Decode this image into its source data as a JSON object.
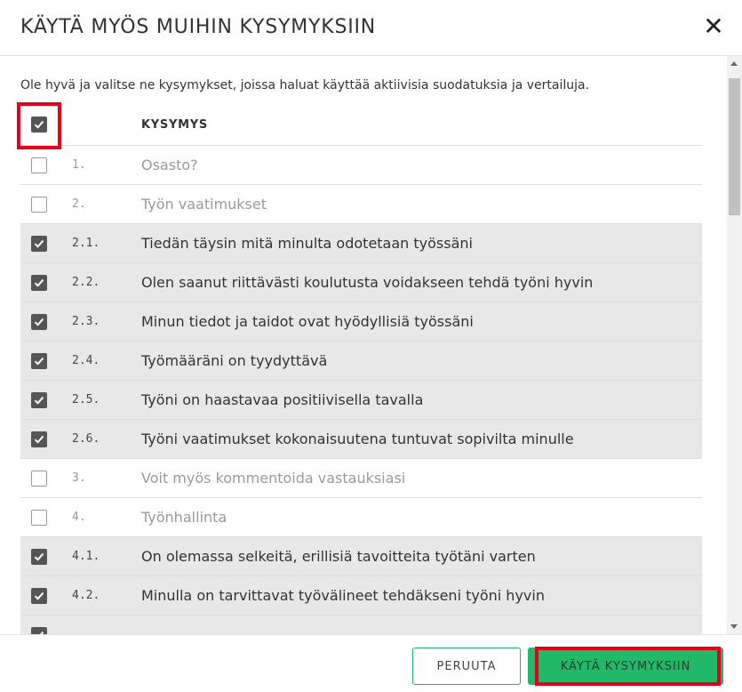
{
  "dialog": {
    "title": "KÄYTÄ MYÖS MUIHIN KYSYMYKSIIN",
    "close_icon": "close-icon",
    "intro": "Ole hyvä ja valitse ne kysymykset, joissa haluat käyttää aktiivisia suodatuksia ja vertailuja."
  },
  "table": {
    "column_header": "KYSYMYS",
    "select_all_checked": true,
    "rows": [
      {
        "number": "1.",
        "text": "Osasto?",
        "checked": false,
        "muted": true
      },
      {
        "number": "2.",
        "text": "Työn vaatimukset",
        "checked": false,
        "muted": true
      },
      {
        "number": "2.1.",
        "text": "Tiedän täysin mitä minulta odotetaan työssäni",
        "checked": true,
        "muted": false
      },
      {
        "number": "2.2.",
        "text": "Olen saanut riittävästi koulutusta voidakseen tehdä työni hyvin",
        "checked": true,
        "muted": false
      },
      {
        "number": "2.3.",
        "text": "Minun tiedot ja taidot ovat hyödyllisiä työssäni",
        "checked": true,
        "muted": false
      },
      {
        "number": "2.4.",
        "text": "Työmääräni on tyydyttävä",
        "checked": true,
        "muted": false
      },
      {
        "number": "2.5.",
        "text": "Työni on haastavaa positiivisella tavalla",
        "checked": true,
        "muted": false
      },
      {
        "number": "2.6.",
        "text": "Työni vaatimukset kokonaisuutena tuntuvat sopivilta minulle",
        "checked": true,
        "muted": false
      },
      {
        "number": "3.",
        "text": "Voit myös kommentoida vastauksiasi",
        "checked": false,
        "muted": true
      },
      {
        "number": "4.",
        "text": "Työnhallinta",
        "checked": false,
        "muted": true
      },
      {
        "number": "4.1.",
        "text": "On olemassa selkeitä, erillisiä tavoitteita työtäni varten",
        "checked": true,
        "muted": false
      },
      {
        "number": "4.2.",
        "text": "Minulla on tarvittavat työvälineet tehdäkseni työni hyvin",
        "checked": true,
        "muted": false
      },
      {
        "number": "",
        "text": "",
        "checked": true,
        "muted": false
      }
    ]
  },
  "footer": {
    "cancel_label": "PERUUTA",
    "apply_label": "KÄYTÄ KYSYMYKSIIN"
  },
  "colors": {
    "accent": "#22b86a",
    "highlight": "#e3001b",
    "checked_row": "#e8e8e8"
  }
}
